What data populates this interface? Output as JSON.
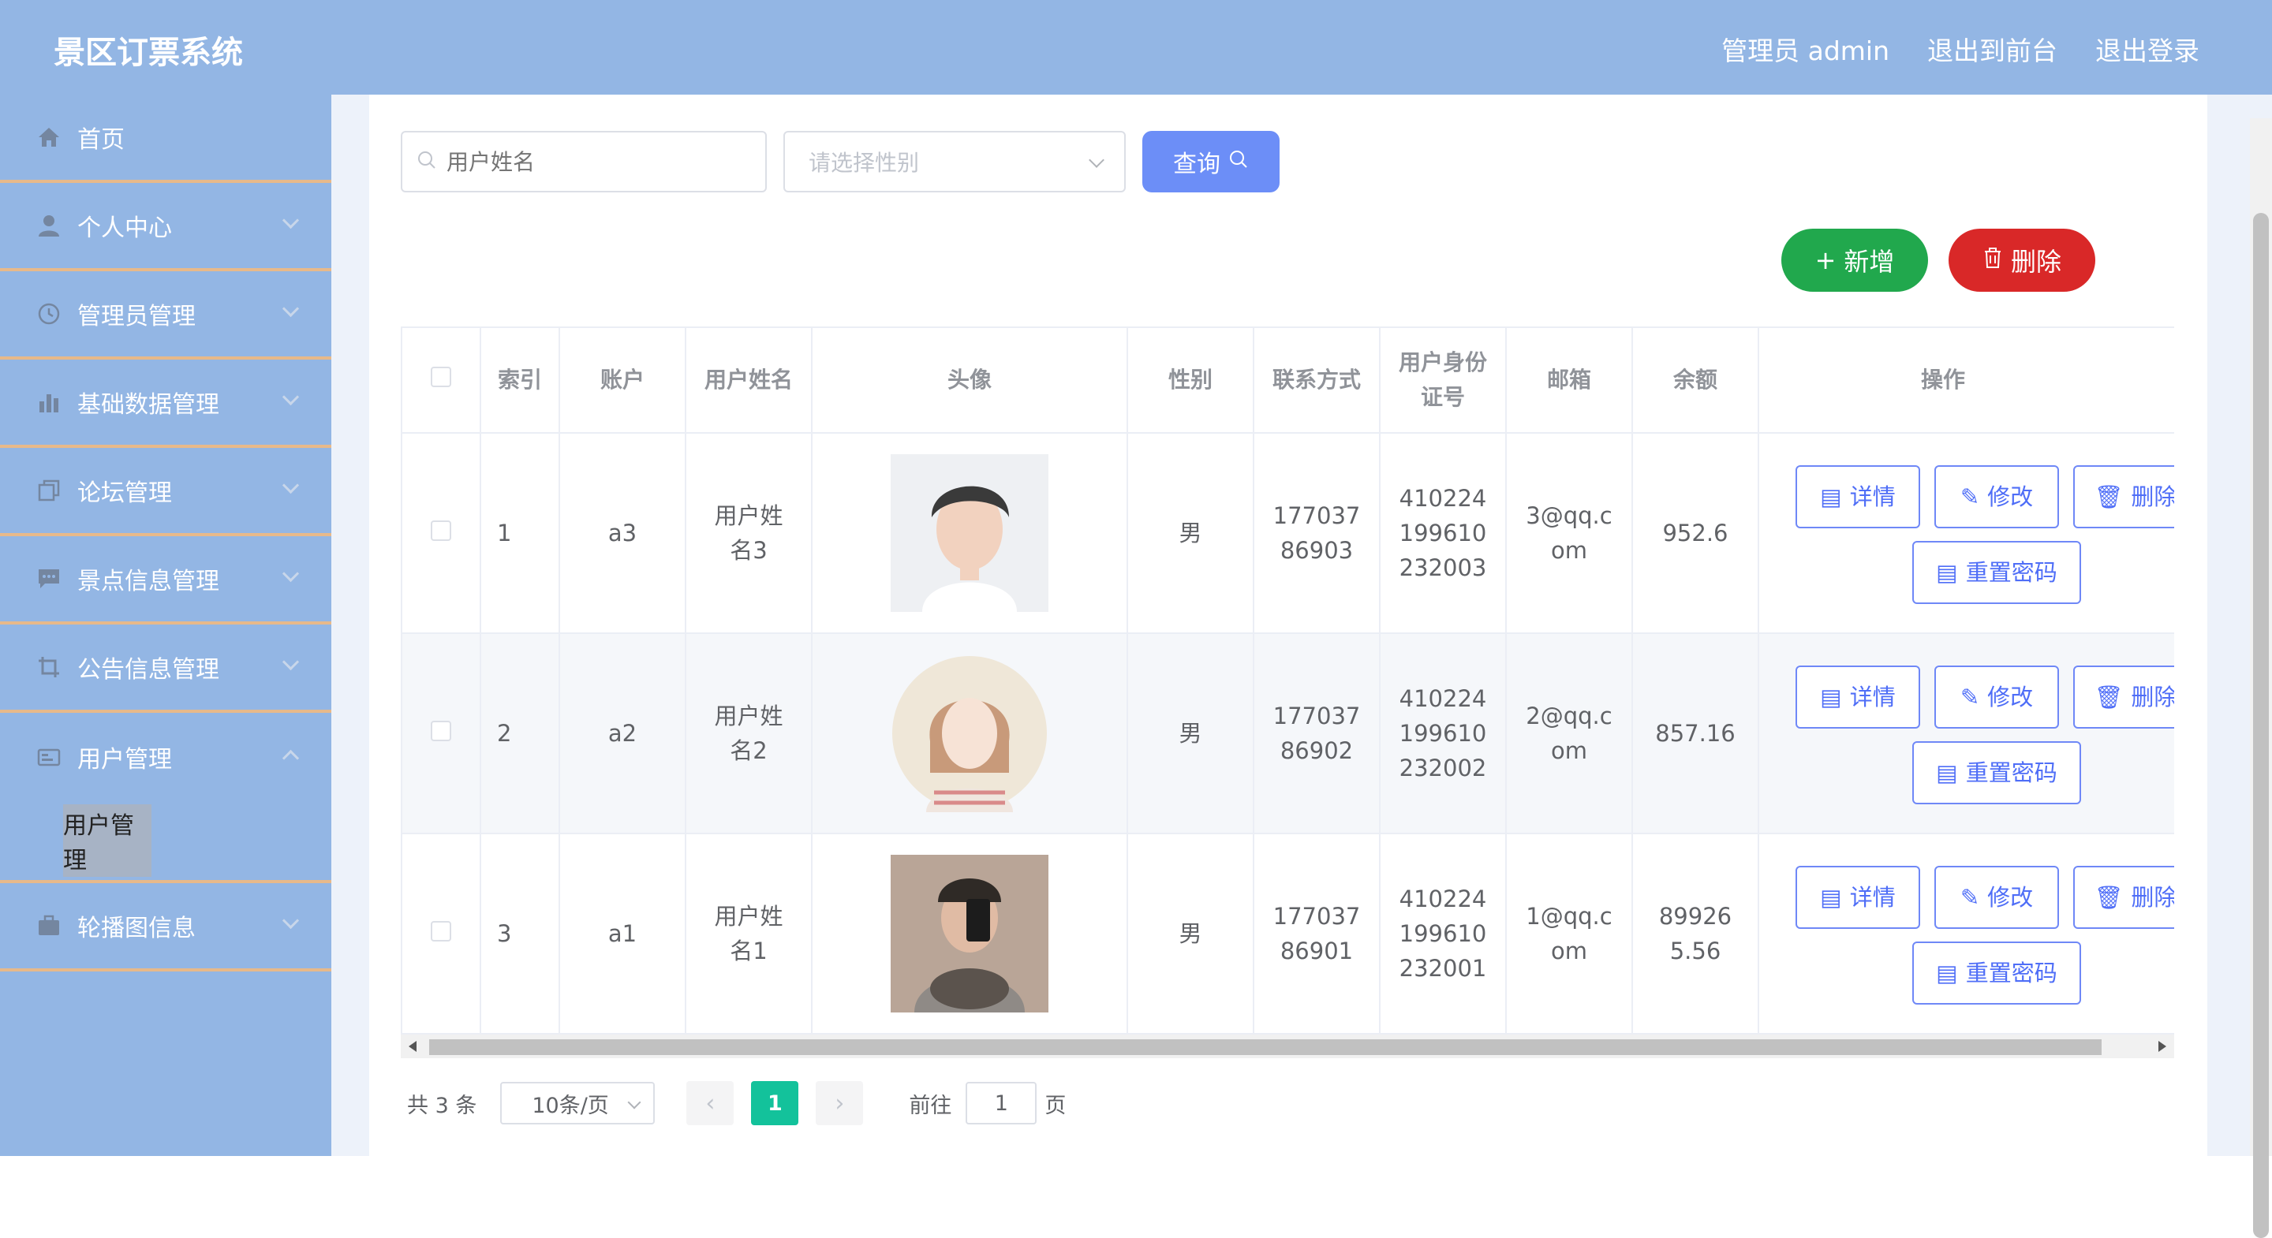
{
  "header": {
    "brand": "景区订票系统",
    "admin_label": "管理员 admin",
    "to_front": "退出到前台",
    "logout": "退出登录"
  },
  "sidebar": {
    "items": [
      {
        "label": "首页",
        "icon": "home-icon"
      },
      {
        "label": "个人中心",
        "icon": "user-icon"
      },
      {
        "label": "管理员管理",
        "icon": "clock-icon"
      },
      {
        "label": "基础数据管理",
        "icon": "bar-chart-icon"
      },
      {
        "label": "论坛管理",
        "icon": "copy-icon"
      },
      {
        "label": "景点信息管理",
        "icon": "message-icon"
      },
      {
        "label": "公告信息管理",
        "icon": "crop-icon"
      },
      {
        "label": "用户管理",
        "icon": "id-card-icon"
      },
      {
        "label": "轮播图信息",
        "icon": "briefcase-icon"
      }
    ],
    "sub_item": "用户管理"
  },
  "search": {
    "name_placeholder": "用户姓名",
    "gender_placeholder": "请选择性别",
    "query_label": "查询"
  },
  "actions": {
    "add_label": "新增",
    "delete_label": "删除"
  },
  "table": {
    "headers": [
      "索引",
      "账户",
      "用户姓名",
      "头像",
      "性别",
      "联系方式",
      "用户身份证号",
      "邮箱",
      "余额",
      "操作"
    ],
    "rows": [
      {
        "index": "1",
        "account": "a3",
        "name": "用户姓名3",
        "gender": "男",
        "phone": "17703786903",
        "id": "410224199610232003",
        "email": "3@qq.com",
        "balance": "952.6"
      },
      {
        "index": "2",
        "account": "a2",
        "name": "用户姓名2",
        "gender": "男",
        "phone": "17703786902",
        "id": "410224199610232002",
        "email": "2@qq.com",
        "balance": "857.16"
      },
      {
        "index": "3",
        "account": "a1",
        "name": "用户姓名1",
        "gender": "男",
        "phone": "17703786901",
        "id": "410224199610232001",
        "email": "1@qq.com",
        "balance": "899265.56"
      }
    ],
    "op_labels": {
      "detail": "详情",
      "edit": "修改",
      "delete": "删除",
      "reset": "重置密码"
    }
  },
  "pagination": {
    "total": "共 3 条",
    "page_size": "10条/页",
    "current": "1",
    "goto": "前往",
    "goto_value": "1",
    "page_unit": "页"
  },
  "colors": {
    "sidebar": "#93b6e4",
    "accent": "#6c8ef7",
    "add": "#21a84d",
    "delete": "#d92828",
    "current_page": "#13c29b"
  }
}
